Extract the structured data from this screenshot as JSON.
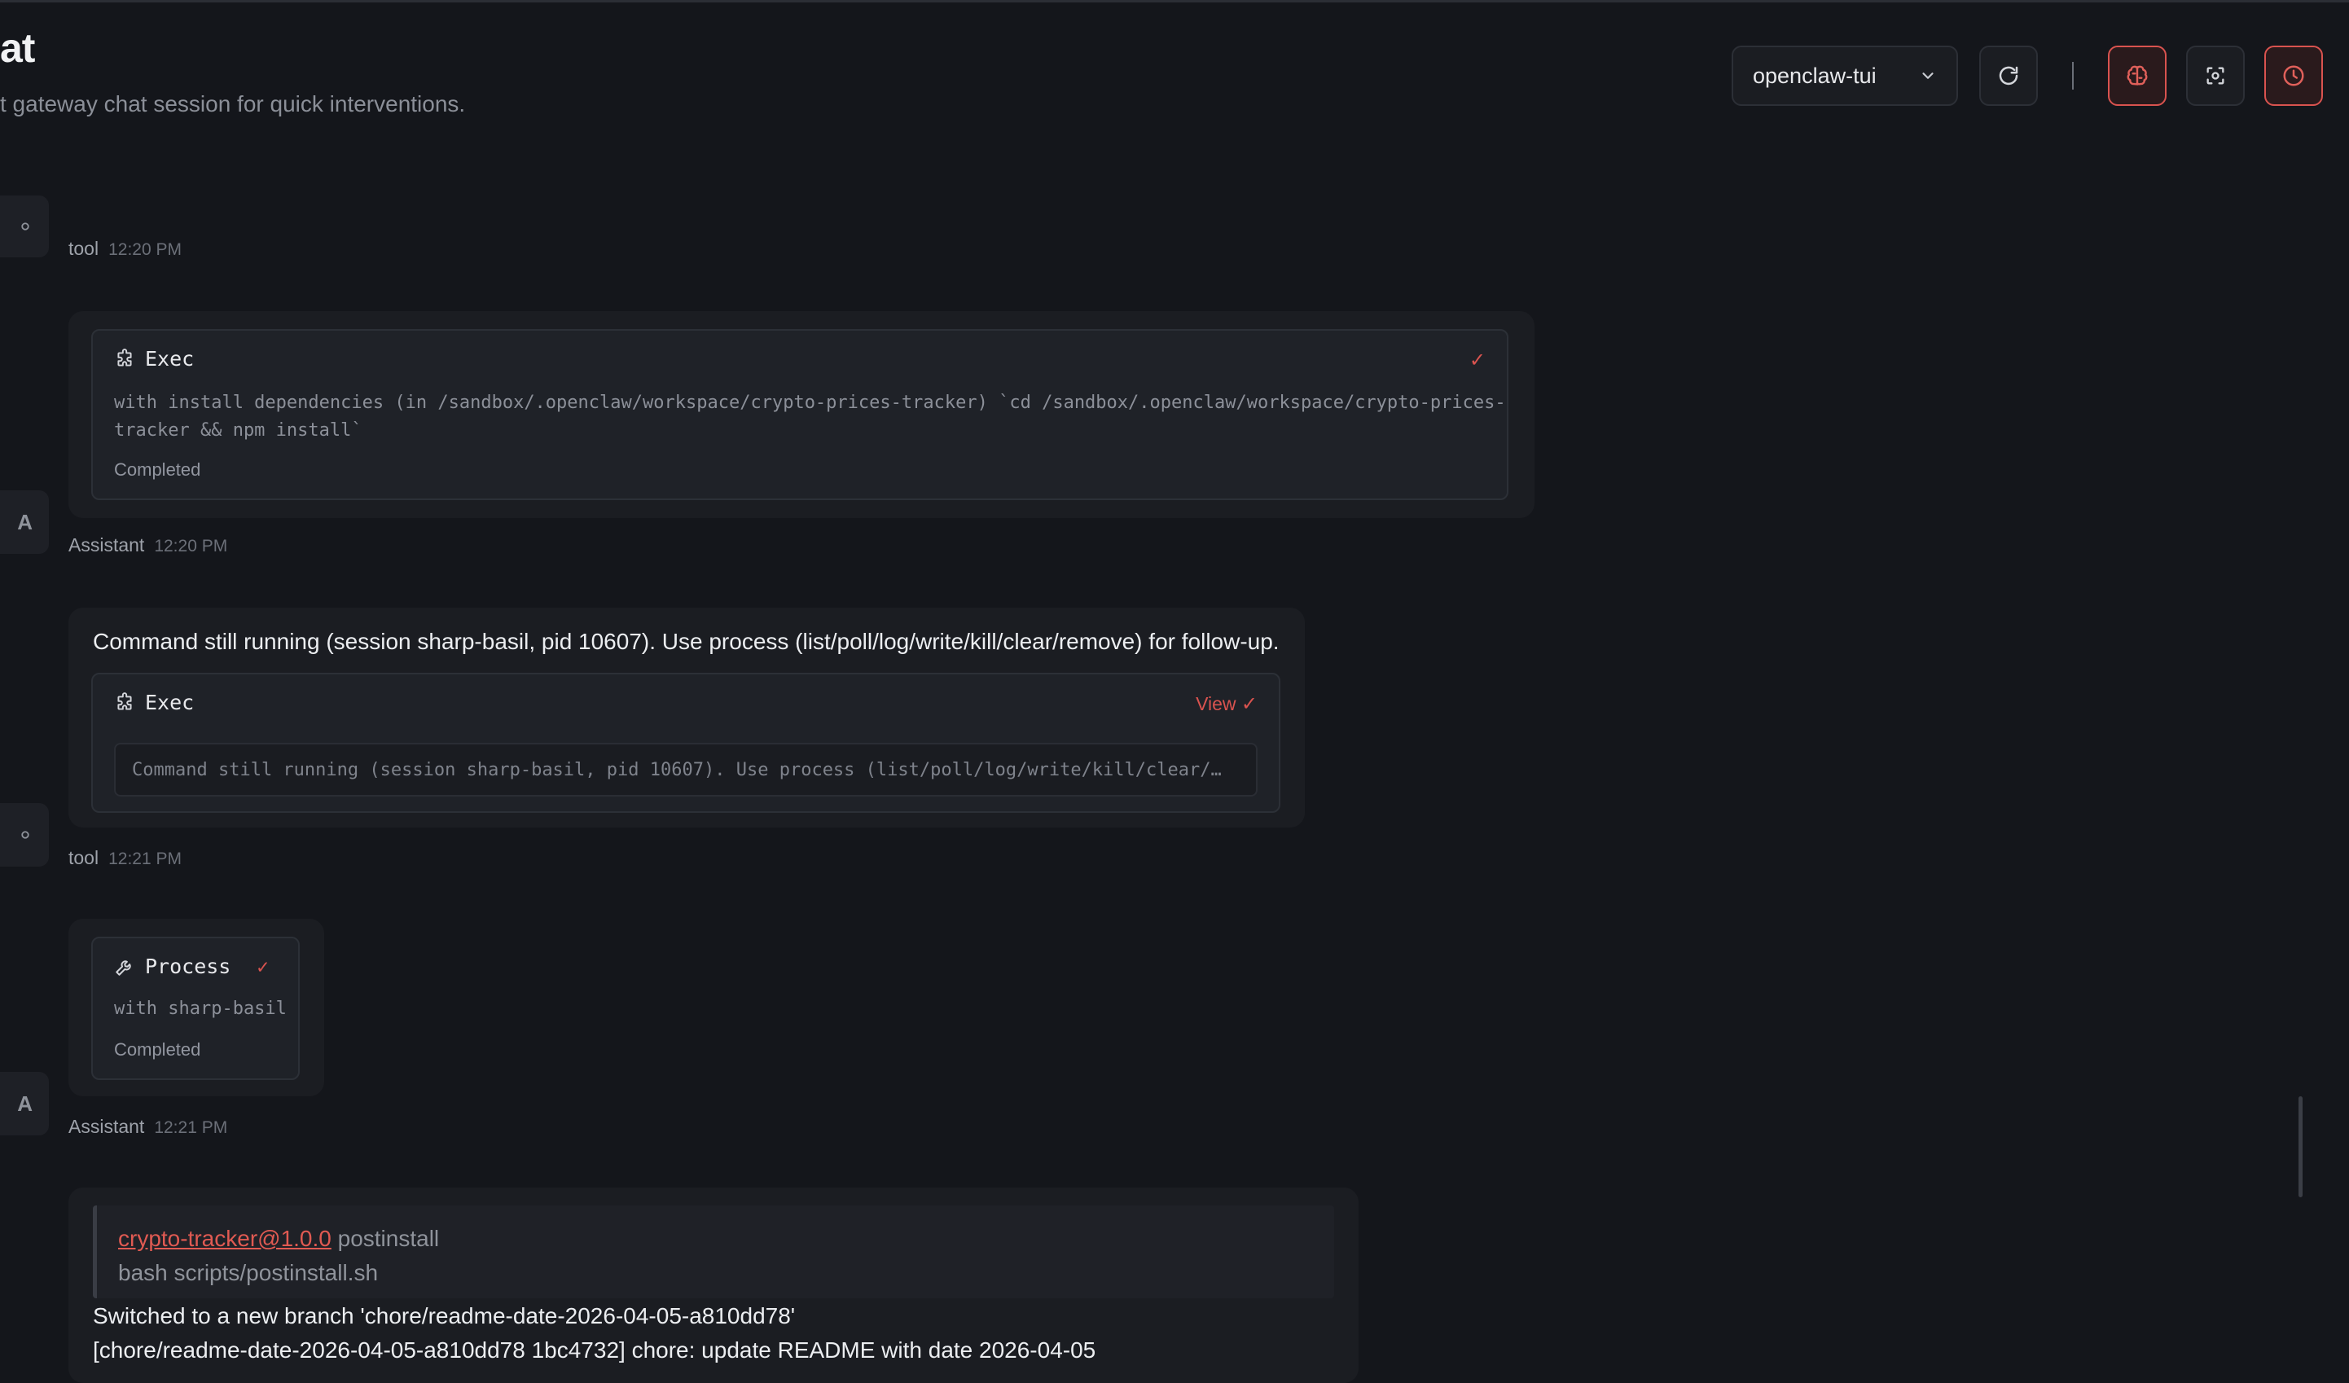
{
  "header": {
    "title": "at",
    "subtitle": "t gateway chat session for quick interventions.",
    "session_select": "openclaw-tui"
  },
  "icons": {
    "refresh": "refresh-icon",
    "brain": "brain-icon",
    "focus": "focus-icon",
    "clock": "clock-icon",
    "tool": "puzzle-icon",
    "wrench": "wrench-icon"
  },
  "colors": {
    "accent": "#d9534f",
    "background": "#14161b",
    "card": "#1f2228"
  },
  "messages": [
    {
      "role": "tool",
      "time": "12:20 PM"
    },
    {
      "role_avatar": "A",
      "tool_card": {
        "title": "Exec",
        "command": "with install dependencies (in /sandbox/.openclaw/workspace/crypto-prices-tracker) `cd /sandbox/.openclaw/workspace/crypto-prices-",
        "command_line2": "tracker && npm install`",
        "status": "Completed"
      }
    },
    {
      "role": "Assistant",
      "time": "12:20 PM"
    },
    {
      "text": "Command still running (session sharp-basil, pid 10607). Use process (list/poll/log/write/kill/clear/remove) for follow-up.",
      "tool_card": {
        "title": "Exec",
        "view_label": "View",
        "output": "Command still running (session sharp-basil, pid 10607). Use process (list/poll/log/write/kill/clear/…"
      }
    },
    {
      "role": "tool",
      "time": "12:21 PM"
    },
    {
      "role_avatar": "A",
      "tool_card": {
        "title": "Process",
        "command": "with sharp-basil",
        "status": "Completed"
      }
    },
    {
      "role": "Assistant",
      "time": "12:21 PM"
    },
    {
      "quote_link": "crypto-tracker@1.0.0",
      "quote_after_link": " postinstall",
      "quote_line2": "bash scripts/postinstall.sh",
      "line1": "Switched to a new branch 'chore/readme-date-2026-04-05-a810dd78'",
      "line2": "[chore/readme-date-2026-04-05-a810dd78 1bc4732] chore: update README with date 2026-04-05"
    }
  ]
}
